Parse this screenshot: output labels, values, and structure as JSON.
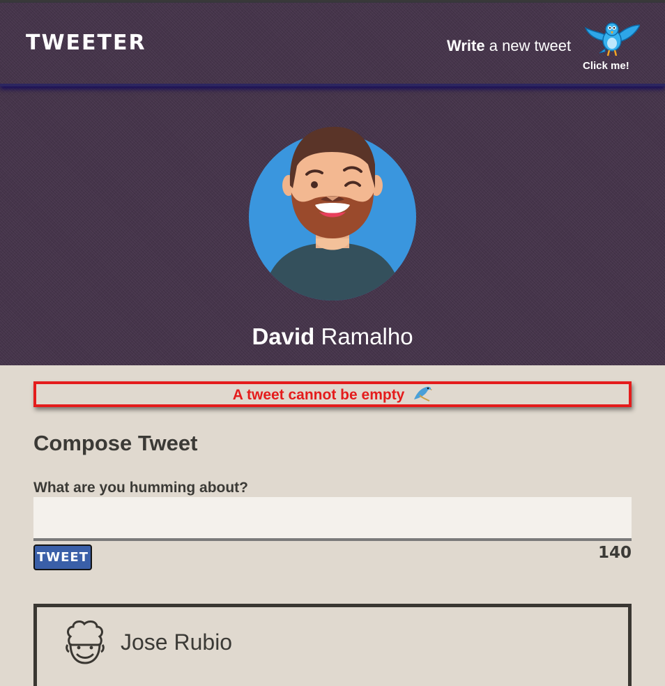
{
  "header": {
    "logo": "TWEETER",
    "write_bold": "Write",
    "write_rest": " a new tweet",
    "compose_button_label": "Click me!"
  },
  "profile": {
    "first_name": "David",
    "last_name": "Ramalho"
  },
  "error": {
    "message": "A tweet cannot be empty"
  },
  "compose": {
    "title": "Compose Tweet",
    "label": "What are you humming about?",
    "input_value": "",
    "submit_label": "TWEET",
    "char_counter": "140"
  },
  "tweets": [
    {
      "author": "Jose Rubio"
    }
  ],
  "colors": {
    "hero_bg": "#45344a",
    "page_bg": "#e0d9cf",
    "error": "#e41c1c",
    "tweet_button": "#3a5fa8"
  }
}
